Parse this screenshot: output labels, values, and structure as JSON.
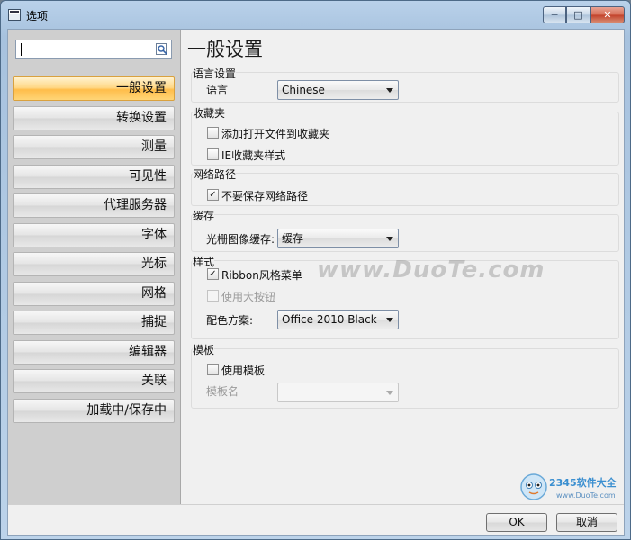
{
  "window": {
    "title": "选项"
  },
  "search": {
    "value": ""
  },
  "nav": {
    "items": [
      {
        "label": "一般设置",
        "active": true
      },
      {
        "label": "转换设置"
      },
      {
        "label": "测量"
      },
      {
        "label": "可见性"
      },
      {
        "label": "代理服务器"
      },
      {
        "label": "字体"
      },
      {
        "label": "光标"
      },
      {
        "label": "网格"
      },
      {
        "label": "捕捉"
      },
      {
        "label": "编辑器"
      },
      {
        "label": "关联"
      },
      {
        "label": "加载中/保存中"
      }
    ]
  },
  "page": {
    "title": "一般设置"
  },
  "language": {
    "group": "语言设置",
    "label": "语言",
    "value": "Chinese"
  },
  "favorites": {
    "group": "收藏夹",
    "add_open_files": "添加打开文件到收藏夹",
    "ie_style": "IE收藏夹样式"
  },
  "network": {
    "group": "网络路径",
    "dont_save": "不要保存网络路径"
  },
  "cache": {
    "group": "缓存",
    "label": "光栅图像缓存:",
    "value": "缓存"
  },
  "style": {
    "group": "样式",
    "ribbon_menu": "Ribbon风格菜单",
    "large_buttons": "使用大按钮",
    "scheme_label": "配色方案:",
    "scheme_value": "Office 2010 Black"
  },
  "template": {
    "group": "模板",
    "use_template": "使用模板",
    "name_label": "模板名",
    "name_value": ""
  },
  "watermark": {
    "text": "www.DuoTe.com"
  },
  "footer": {
    "ok": "OK",
    "cancel": "取消"
  },
  "logo": {
    "text": "2345软件大全",
    "url": "www.DuoTe.com"
  },
  "colors": {
    "nav_active": "#ffbd4a",
    "title_bar": "#b9d1ea",
    "close_button": "#c2412a"
  }
}
